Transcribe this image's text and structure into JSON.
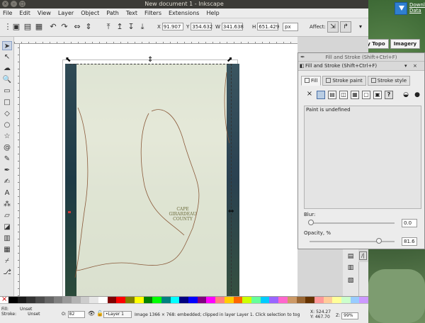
{
  "window": {
    "title": "New document 1 - Inkscape"
  },
  "menubar": [
    "File",
    "Edit",
    "View",
    "Layer",
    "Object",
    "Path",
    "Text",
    "Filters",
    "Extensions",
    "Help"
  ],
  "toolbar": {
    "x_label": "X",
    "x_value": "91.907",
    "y_label": "Y",
    "y_value": "354.632",
    "w_label": "W",
    "w_value": "341.638",
    "h_label": "H",
    "h_value": "651.429",
    "unit": "px",
    "affect_label": "Affect:"
  },
  "background": {
    "download_text": "Download Data",
    "tabs": [
      "ery Topo",
      "Imagery"
    ]
  },
  "canvas": {
    "county_label": "CAPE\nGIRARDEAU\nCOUNTY"
  },
  "dialog": {
    "title": "Fill and Stroke (Shift+Ctrl+F)",
    "tab_title": "Fill and Stroke (Shift+Ctrl+F)",
    "tabs": [
      "Fill",
      "Stroke paint",
      "Stroke style"
    ],
    "paint_message": "Paint is undefined",
    "blur_label": "Blur:",
    "blur_value": "0.0",
    "opacity_label": "Opacity, %",
    "opacity_value": "81.6",
    "opacity_fraction": 0.816
  },
  "palette": [
    "#000000",
    "#1a1a1a",
    "#333333",
    "#4d4d4d",
    "#666666",
    "#808080",
    "#999999",
    "#b3b3b3",
    "#cccccc",
    "#e6e6e6",
    "#ffffff",
    "#800000",
    "#ff0000",
    "#808000",
    "#ffff00",
    "#008000",
    "#00ff00",
    "#008080",
    "#00ffff",
    "#000080",
    "#0000ff",
    "#800080",
    "#ff00ff",
    "#ff8080",
    "#ffcc00",
    "#ff6600",
    "#ccff00",
    "#66ff99",
    "#00ccff",
    "#9966ff",
    "#ff66cc",
    "#cc9966",
    "#996633",
    "#663300",
    "#ff9999",
    "#ffcc99",
    "#ffff99",
    "#ccffcc",
    "#99ccff",
    "#cc99ff"
  ],
  "status": {
    "fill_label": "Fill:",
    "fill_value": "Unset",
    "stroke_label": "Stroke:",
    "stroke_value": "Unset",
    "opacity_label": "O:",
    "opacity_value": "82",
    "layer": "•Layer 1",
    "message": "Image 1366 × 768: embedded; clipped in layer Layer 1. Click selection to tog",
    "x_coord": "524.27",
    "y_coord": "467.70",
    "x_label": "X:",
    "y_label": "Y:",
    "zoom_label": "Z:",
    "zoom_value": "99%"
  }
}
